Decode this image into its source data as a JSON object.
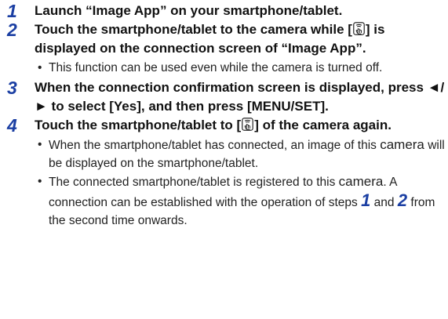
{
  "steps": [
    {
      "number": "1",
      "text": "Launch “Image App” on your smartphone/tablet."
    },
    {
      "number": "2",
      "text_before_icon": "Touch the smartphone/tablet to the camera while [",
      "text_after_icon": "] is displayed on the connection screen of “Image App”.",
      "bullets": [
        "This function can be used even while the camera is turned off."
      ]
    },
    {
      "number": "3",
      "text": "When the connection confirmation screen is displayed, press ◄/► to select [Yes], and then press [MENU/SET]."
    },
    {
      "number": "4",
      "text_before_icon": "Touch the smartphone/tablet to [",
      "text_after_icon": "] of the camera again.",
      "bullets": [
        {
          "pre": "When the smartphone/tablet has connected, an image of this ",
          "word": "camera",
          "post": " will be displayed on the smartphone/tablet."
        },
        {
          "pre": "The connected smartphone/tablet is registered to this ",
          "word": "camera",
          "mid": ". A connection can be established with the operation of steps ",
          "ref1": "1",
          "and": " and ",
          "ref2": "2",
          "post": " from the second time onwards."
        }
      ]
    }
  ],
  "bullet_symbol": "•",
  "icons": {
    "nfc": "nfc-touch-icon"
  },
  "colors": {
    "step_number": "#1b3fa3",
    "text": "#111111"
  }
}
